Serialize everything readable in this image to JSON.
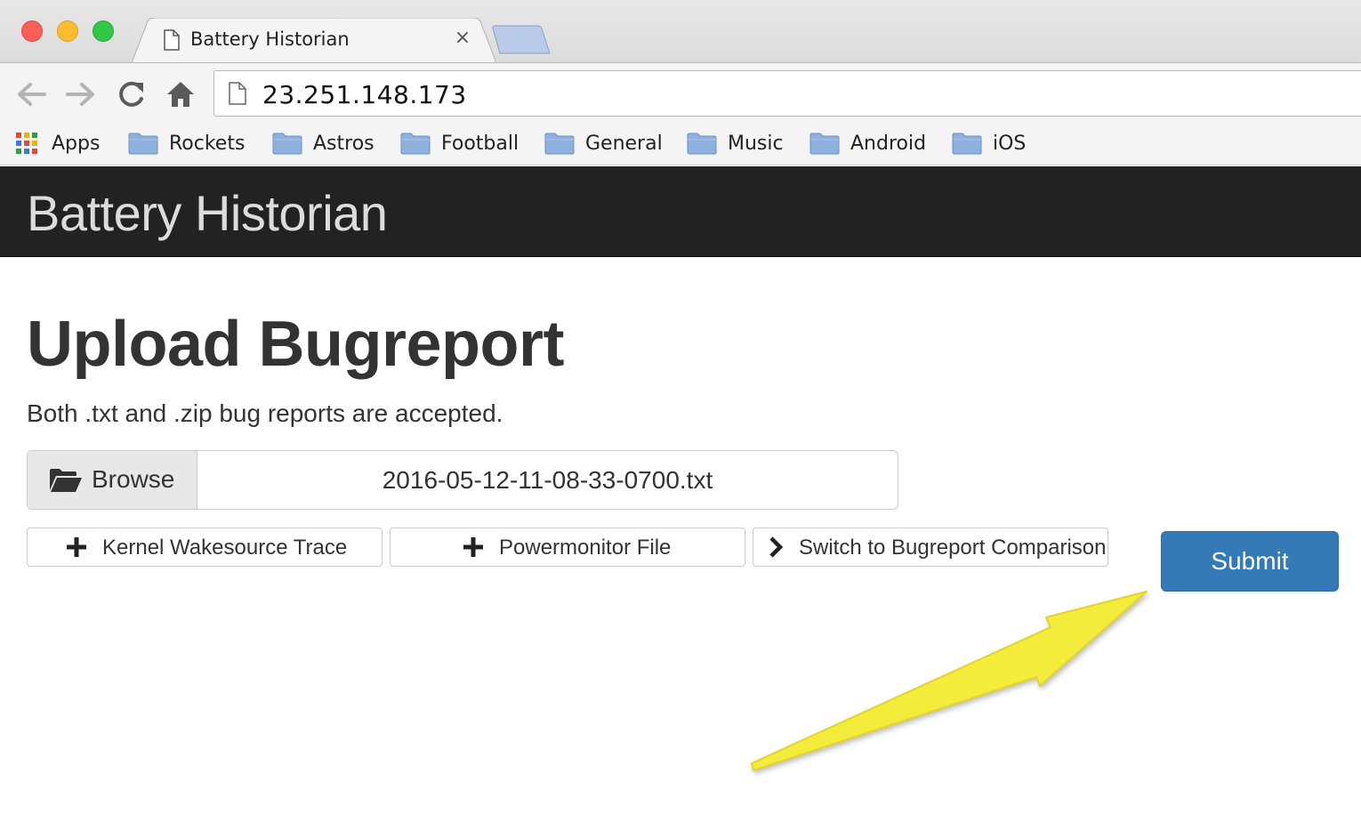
{
  "browser": {
    "tab_title": "Battery Historian",
    "tab_close": "×",
    "address": "23.251.148.173",
    "bookmarks": {
      "apps": "Apps",
      "items": [
        "Rockets",
        "Astros",
        "Football",
        "General",
        "Music",
        "Android",
        "iOS"
      ]
    }
  },
  "navbar": {
    "brand": "Battery Historian"
  },
  "main": {
    "title": "Upload Bugreport",
    "subtitle": "Both .txt and .zip bug reports are accepted.",
    "file_input": {
      "browse_label": "Browse",
      "file_name": "2016-05-12-11-08-33-0700.txt"
    },
    "options": {
      "kernel_trace": "Kernel Wakesource Trace",
      "powermonitor": "Powermonitor File",
      "switch_compare": "Switch to Bugreport Comparison"
    },
    "submit_label": "Submit"
  },
  "colors": {
    "navbar_bg": "#222222",
    "primary_button": "#337ab7",
    "annotation_arrow": "#f4ec3a"
  },
  "icons": {
    "tab": "page-icon",
    "browse": "folder-open-icon",
    "add": "plus-icon",
    "switch": "chevron-right-icon",
    "bookmark_folder": "folder-icon",
    "apps": "apps-grid-icon"
  }
}
